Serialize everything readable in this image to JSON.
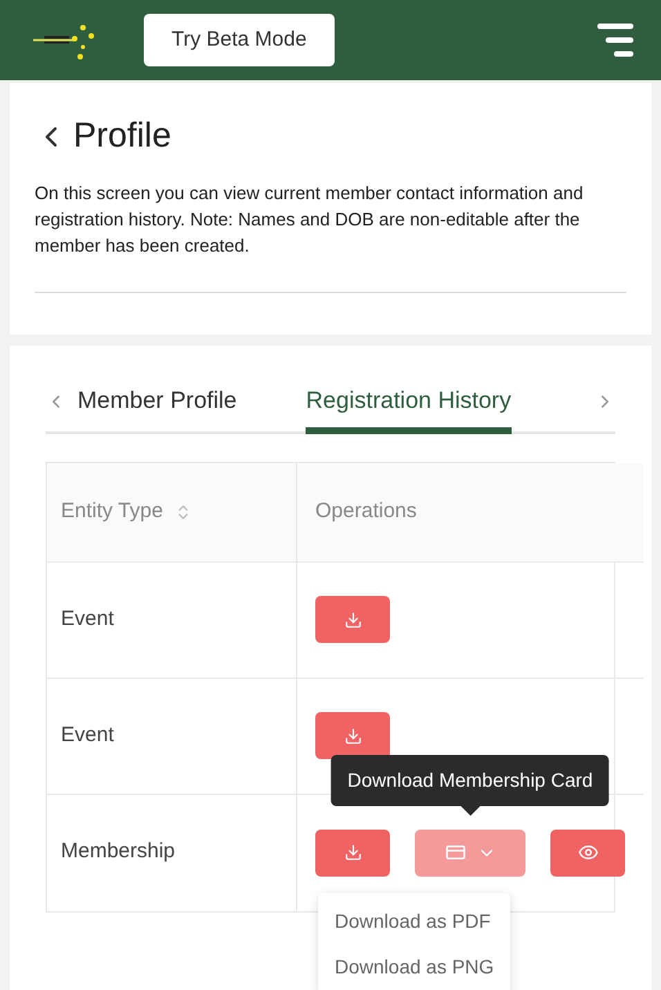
{
  "header": {
    "beta_button": "Try Beta Mode"
  },
  "page": {
    "title": "Profile",
    "description": "On this screen you can view current member contact information and registration history. Note: Names and DOB are non-editable after the member has been created."
  },
  "tabs": [
    {
      "label": "Member Profile",
      "selected": false
    },
    {
      "label": "Registration History",
      "selected": true
    }
  ],
  "table": {
    "columns": [
      "Entity Type",
      "Operations"
    ],
    "rows": [
      {
        "entity_type": "Event",
        "operations": [
          {
            "kind": "download",
            "open": false
          }
        ]
      },
      {
        "entity_type": "Event",
        "operations": [
          {
            "kind": "download",
            "open": false
          }
        ]
      },
      {
        "entity_type": "Membership",
        "operations": [
          {
            "kind": "download",
            "open": false
          },
          {
            "kind": "card",
            "open": true,
            "tooltip": "Download Membership Card",
            "menu": [
              "Download as PDF",
              "Download as PNG"
            ]
          },
          {
            "kind": "view",
            "open": false
          }
        ]
      }
    ]
  }
}
